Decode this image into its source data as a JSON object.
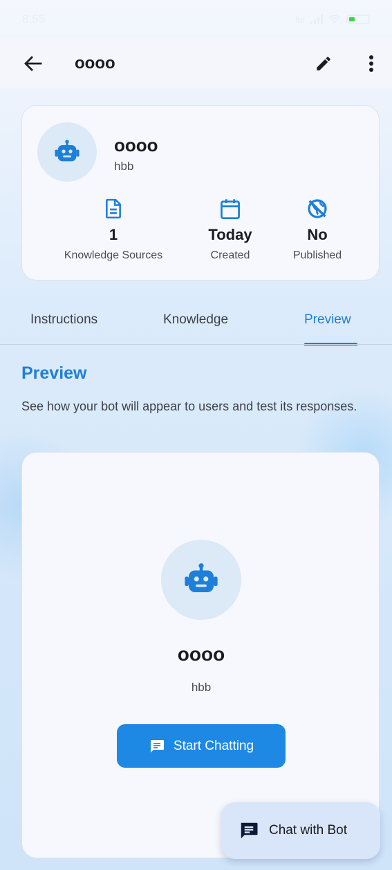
{
  "status_bar": {
    "time": "8:55",
    "signal_text": "lte",
    "icons": [
      "notification-icon",
      "signal-icon",
      "wifi-icon",
      "battery-icon"
    ],
    "battery_color": "#3cd24a"
  },
  "app_bar": {
    "title": "oooo",
    "icons": {
      "back": "arrow-left-icon",
      "edit": "pencil-icon",
      "more": "more-vert-icon"
    }
  },
  "bot": {
    "name": "oooo",
    "description": "hbb",
    "icon": "robot-icon"
  },
  "stats": [
    {
      "icon": "document-icon",
      "value": "1",
      "label": "Knowledge Sources"
    },
    {
      "icon": "calendar-icon",
      "value": "Today",
      "label": "Created"
    },
    {
      "icon": "public-off-icon",
      "value": "No",
      "label": "Published"
    }
  ],
  "tabs": [
    {
      "label": "Instructions",
      "active": false
    },
    {
      "label": "Knowledge",
      "active": false
    },
    {
      "label": "Preview",
      "active": true
    }
  ],
  "preview_section": {
    "title": "Preview",
    "description": "See how your bot will appear to users and test its responses.",
    "bot_name": "oooo",
    "bot_description": "hbb",
    "button_label": "Start Chatting",
    "button_icon": "chat-icon"
  },
  "fab": {
    "label": "Chat with Bot",
    "icon": "chat-icon"
  },
  "colors": {
    "accent": "#1e7fd8",
    "button": "#1e88e5",
    "avatar_bg": "#dce9f7",
    "card_bg": "#f7f8fd",
    "fab_bg": "#d9e6fa"
  }
}
